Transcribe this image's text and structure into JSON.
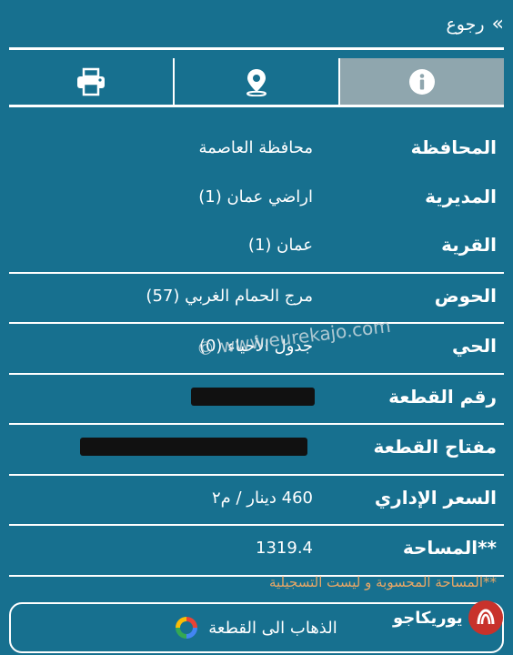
{
  "header": {
    "back_label": "رجوع",
    "back_icon": "double-chevron-right-icon"
  },
  "tabs": [
    {
      "name": "info",
      "icon": "info-icon",
      "active": true
    },
    {
      "name": "location",
      "icon": "location-pin-icon",
      "active": false
    },
    {
      "name": "print",
      "icon": "printer-icon",
      "active": false
    }
  ],
  "details": [
    {
      "label": "المحافظة",
      "value": "محافظة العاصمة"
    },
    {
      "label": "المديرية",
      "value": "اراضي عمان (1)"
    },
    {
      "label": "القرية",
      "value": "عمان (1)"
    },
    {
      "label": "الحوض",
      "value": "مرج الحمام الغربي (57)"
    },
    {
      "label": "الحي",
      "value": "جدول الأحياء (0)"
    },
    {
      "label": "رقم القطعة",
      "value": ""
    },
    {
      "label": "مفتاح القطعة",
      "value": ""
    },
    {
      "label": "السعر الإداري",
      "value": "460 دينار / م٢"
    },
    {
      "label": "**المساحة",
      "value": "1319.4"
    }
  ],
  "watermark": "© www.eurekajo.com",
  "note": "**المساحة المحسوبة و ليست التسجيلية",
  "goto_button": {
    "label": "الذهاب الى القطعة",
    "icon": "google-g-icon"
  },
  "brand": {
    "text": "يوريكاجو",
    "icon": "eureka-logo-icon"
  },
  "colors": {
    "background": "#17708f",
    "active_tab": "#8fa6ae",
    "note": "#e8a766",
    "brand_red": "#c8322b"
  }
}
